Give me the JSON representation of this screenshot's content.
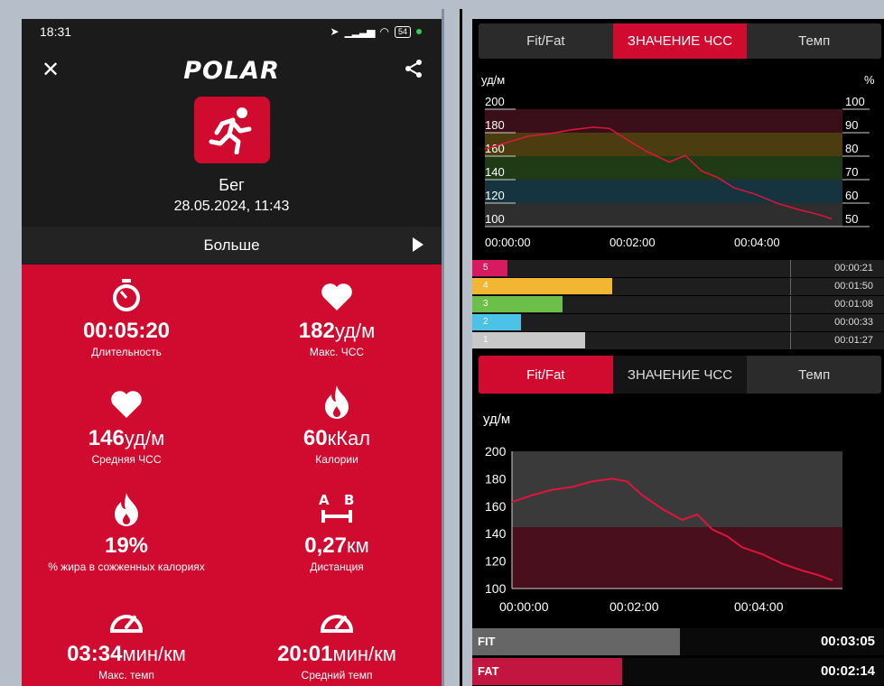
{
  "status": {
    "time": "18:31",
    "battery": "54"
  },
  "app": {
    "logo": "POLAR"
  },
  "session": {
    "sport": "Бег",
    "datetime": "28.05.2024, 11:43"
  },
  "more": {
    "label": "Больше"
  },
  "stats": [
    {
      "value": "00:05:20",
      "unit": "",
      "label": "Длительность",
      "icon": "stopwatch-icon"
    },
    {
      "value": "182",
      "unit": "уд/м",
      "label": "Макс. ЧСС",
      "icon": "heart-icon"
    },
    {
      "value": "146",
      "unit": "уд/м",
      "label": "Средняя ЧСС",
      "icon": "heart-icon"
    },
    {
      "value": "60",
      "unit": "кКал",
      "label": "Калории",
      "icon": "flame-icon"
    },
    {
      "value": "19%",
      "unit": "",
      "label": "% жира в сожженных калориях",
      "icon": "flame-icon"
    },
    {
      "value": "0,27",
      "unit": "км",
      "label": "Дистанция",
      "icon": "distance-ab-icon"
    },
    {
      "value": "03:34",
      "unit": "мин/км",
      "label": "Макс. темп",
      "icon": "speedometer-icon"
    },
    {
      "value": "20:01",
      "unit": "мин/км",
      "label": "Средний темп",
      "icon": "speedometer-icon"
    }
  ],
  "distance_icon": {
    "a": "A",
    "b": "B"
  },
  "tabs_top": [
    "Fit/Fat",
    "ЗНАЧЕНИЕ ЧСС",
    "Темп"
  ],
  "tabs_bottom": [
    "Fit/Fat",
    "ЗНАЧЕНИЕ ЧСС",
    "Темп"
  ],
  "hr_chart": {
    "ylabel": "уд/м",
    "y2label": "%",
    "yticks": [
      "200",
      "180",
      "160",
      "140",
      "120",
      "100"
    ],
    "y2ticks": [
      "100",
      "90",
      "80",
      "70",
      "60",
      "50"
    ],
    "xticks": [
      "00:00:00",
      "00:02:00",
      "00:04:00"
    ]
  },
  "zones": [
    {
      "zone": "5",
      "time": "00:00:21",
      "color": "#d81b60",
      "fraction": 0.2
    },
    {
      "zone": "4",
      "time": "00:01:50",
      "color": "#f2b632",
      "fraction": 1.0
    },
    {
      "zone": "3",
      "time": "00:01:08",
      "color": "#6cc04a",
      "fraction": 0.62
    },
    {
      "zone": "2",
      "time": "00:00:33",
      "color": "#4cc3e6",
      "fraction": 0.3
    },
    {
      "zone": "1",
      "time": "00:01:27",
      "color": "#c8c8c8",
      "fraction": 0.79
    }
  ],
  "ff_chart": {
    "ylabel": "уд/м",
    "yticks": [
      "200",
      "180",
      "160",
      "140",
      "120",
      "100"
    ],
    "xticks": [
      "00:00:00",
      "00:02:00",
      "00:04:00"
    ]
  },
  "fitfat": [
    {
      "label": "FIT",
      "time": "00:03:05",
      "color": "#666666",
      "fraction": 1.0
    },
    {
      "label": "FAT",
      "time": "00:02:14",
      "color": "#c2153f",
      "fraction": 0.72
    }
  ],
  "chart_data": [
    {
      "type": "line",
      "ylabel": "уд/м",
      "xticks": [
        "00:00:00",
        "00:02:00",
        "00:04:00"
      ],
      "ylim": [
        100,
        200
      ],
      "x_seconds": [
        0,
        20,
        40,
        60,
        80,
        100,
        115,
        130,
        150,
        170,
        185,
        200,
        215,
        230,
        250,
        270,
        290,
        305,
        320
      ],
      "series": [
        {
          "values": [
            160,
            165,
            170,
            172,
            175,
            177,
            176,
            168,
            158,
            150,
            155,
            143,
            138,
            130,
            125,
            118,
            113,
            110,
            106
          ]
        }
      ]
    },
    {
      "type": "line",
      "ylabel": "уд/м",
      "xticks": [
        "00:00:00",
        "00:02:00",
        "00:04:00"
      ],
      "ylim": [
        100,
        200
      ],
      "x_seconds": [
        0,
        20,
        40,
        60,
        80,
        100,
        115,
        130,
        150,
        170,
        185,
        200,
        215,
        230,
        250,
        270,
        290,
        305,
        320
      ],
      "series": [
        {
          "values": [
            163,
            168,
            172,
            174,
            178,
            180,
            178,
            168,
            158,
            150,
            154,
            143,
            138,
            130,
            125,
            118,
            113,
            110,
            106
          ]
        }
      ]
    }
  ]
}
